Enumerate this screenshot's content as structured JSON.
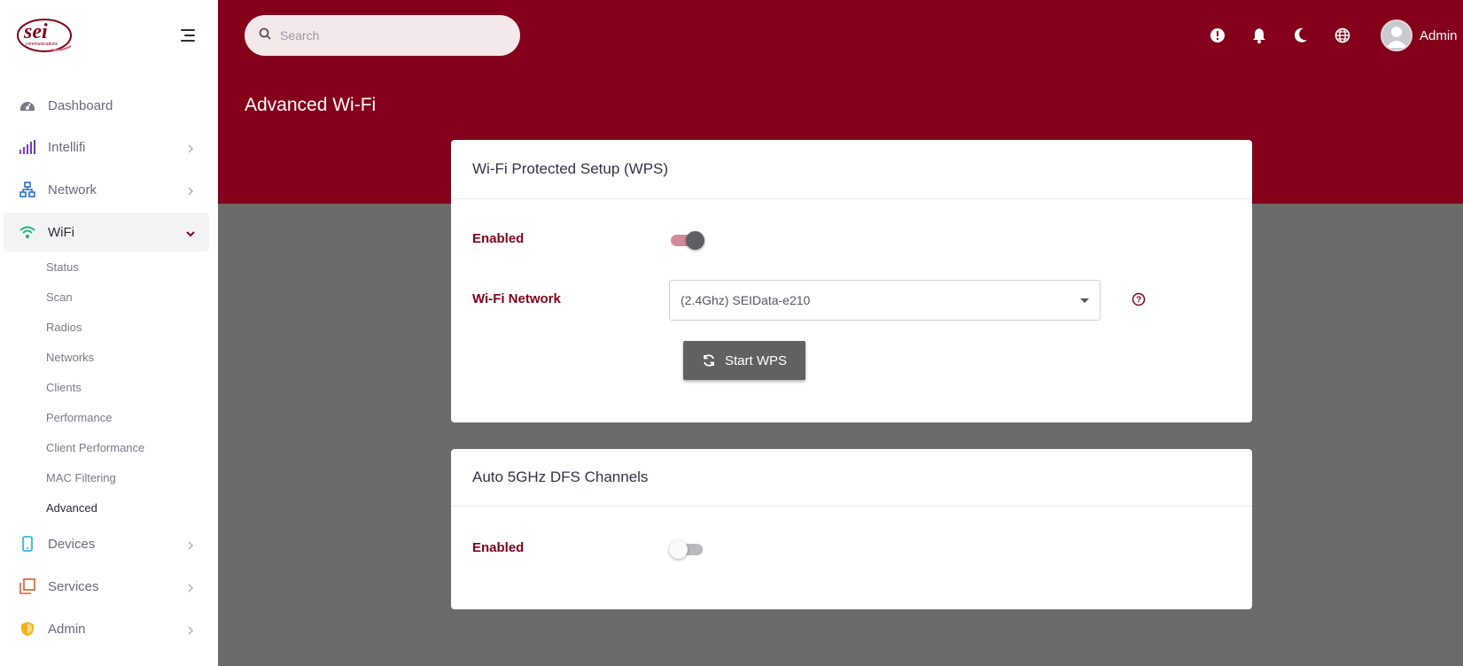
{
  "brand": {
    "logo_text": "sei",
    "logo_subtext": "communications"
  },
  "search": {
    "placeholder": "Search"
  },
  "user": {
    "name": "Admin"
  },
  "page": {
    "title": "Advanced Wi-Fi"
  },
  "sidebar": {
    "items": [
      {
        "label": "Dashboard"
      },
      {
        "label": "Intellifi"
      },
      {
        "label": "Network"
      },
      {
        "label": "WiFi"
      },
      {
        "label": "Devices"
      },
      {
        "label": "Services"
      },
      {
        "label": "Admin"
      }
    ],
    "wifi_sub": [
      {
        "label": "Status"
      },
      {
        "label": "Scan"
      },
      {
        "label": "Radios"
      },
      {
        "label": "Networks"
      },
      {
        "label": "Clients"
      },
      {
        "label": "Performance"
      },
      {
        "label": "Client Performance"
      },
      {
        "label": "MAC Filtering"
      },
      {
        "label": "Advanced"
      }
    ]
  },
  "wps": {
    "title": "Wi-Fi Protected Setup (WPS)",
    "enabled_label": "Enabled",
    "enabled": true,
    "network_label": "Wi-Fi Network",
    "network_value": "(2.4Ghz) SEIData-e210",
    "start_button": "Start WPS"
  },
  "dfs": {
    "title": "Auto 5GHz DFS Channels",
    "enabled_label": "Enabled",
    "enabled": false
  },
  "colors": {
    "brand": "#85001a",
    "background": "#6b6b6b",
    "button": "#616161"
  }
}
